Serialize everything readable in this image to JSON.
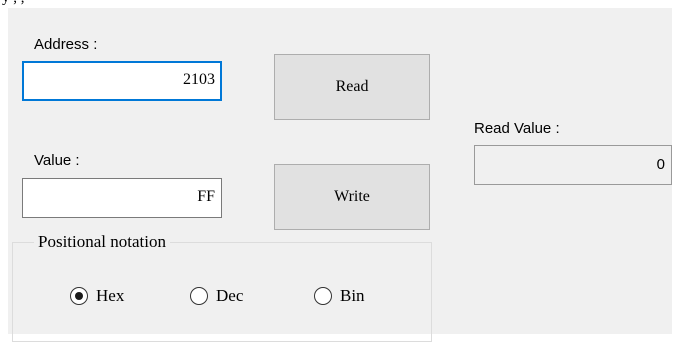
{
  "address": {
    "label": "Address :",
    "value": "2103"
  },
  "value": {
    "label": "Value :",
    "value": "FF"
  },
  "buttons": {
    "read": "Read",
    "write": "Write"
  },
  "read_value": {
    "label": "Read Value :",
    "value": "0"
  },
  "notation": {
    "title": "Positional notation",
    "options": [
      "Hex",
      "Dec",
      "Bin"
    ],
    "selected": "Hex"
  },
  "colors": {
    "panel": "#f0f0f0",
    "focus_border": "#0078d7",
    "button": "#e1e1e1"
  }
}
